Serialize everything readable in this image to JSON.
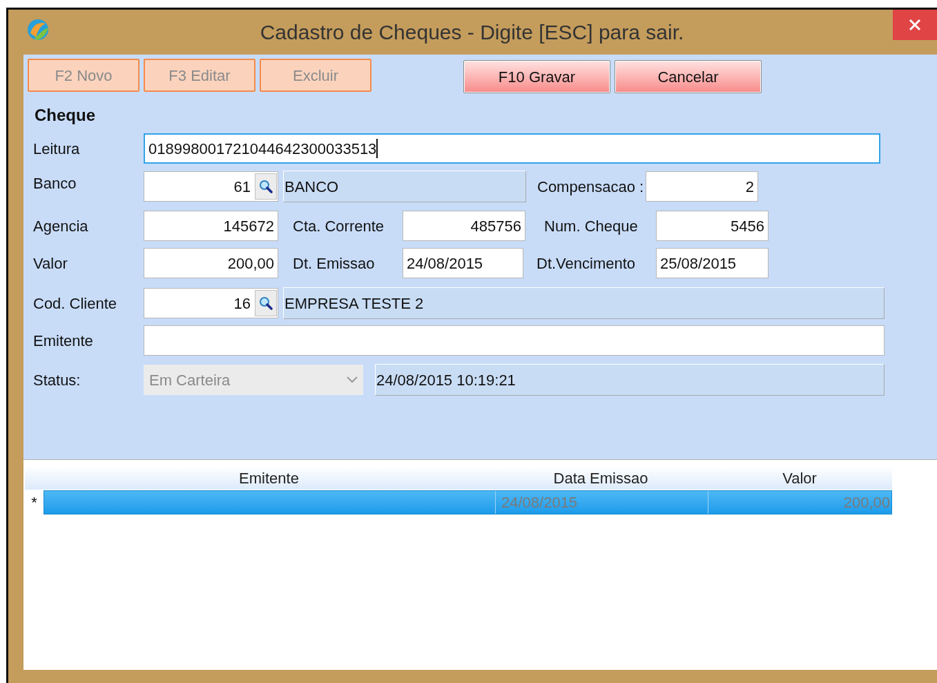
{
  "window": {
    "title": "Cadastro de Cheques - Digite [ESC] para sair."
  },
  "toolbar": {
    "left": [
      {
        "label": "F2 Novo",
        "disabled": true
      },
      {
        "label": "F3 Editar",
        "disabled": true
      },
      {
        "label": "Excluir",
        "disabled": true
      }
    ],
    "right": [
      {
        "label": "F10 Gravar",
        "disabled": false
      },
      {
        "label": "Cancelar",
        "disabled": false
      }
    ]
  },
  "section_title": "Cheque",
  "leitura": {
    "label": "Leitura",
    "value": "018998001721044642300033513",
    "focused": true
  },
  "banco": {
    "label": "Banco",
    "code": "61",
    "name": "BANCO"
  },
  "compensacao": {
    "label": "Compensacao :",
    "value": "2"
  },
  "agencia": {
    "label": "Agencia",
    "value": "145672"
  },
  "cta_corrente": {
    "label": "Cta. Corrente",
    "value": "485756"
  },
  "num_cheque": {
    "label": "Num. Cheque",
    "value": "5456"
  },
  "valor": {
    "label": "Valor",
    "value": "200,00"
  },
  "dt_emissao": {
    "label": "Dt. Emissao",
    "value": "24/08/2015"
  },
  "dt_vencimento": {
    "label": "Dt.Vencimento",
    "value": "25/08/2015"
  },
  "cliente": {
    "label": "Cod. Cliente",
    "code": "16",
    "name": "EMPRESA TESTE 2"
  },
  "emitente": {
    "label": "Emitente"
  },
  "status": {
    "label": "Status:",
    "value": "Em Carteira",
    "disabled": true,
    "timestamp": "24/08/2015 10:19:21"
  },
  "grid": {
    "columns": [
      "Emitente",
      "Data Emissao",
      "Valor"
    ],
    "rows": [
      {
        "marker": "*",
        "data_emissao": "24/08/2015",
        "valor": "200,00",
        "selected": true
      }
    ]
  }
}
